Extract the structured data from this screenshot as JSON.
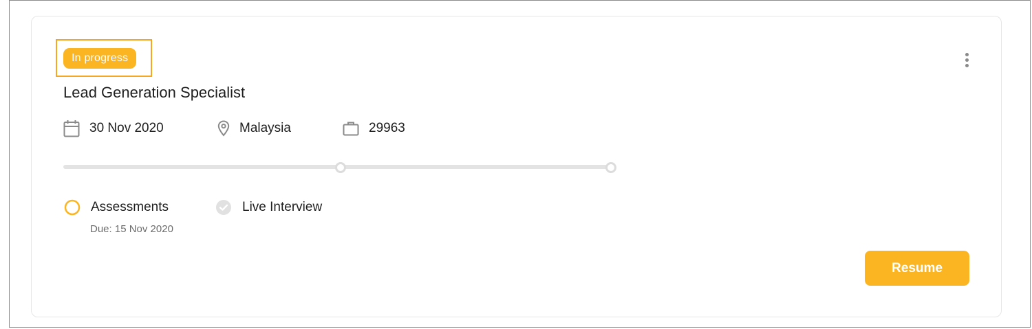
{
  "card": {
    "status_badge": "In progress",
    "job_title": "Lead Generation Specialist",
    "meta": {
      "date": "30 Nov 2020",
      "location": "Malaysia",
      "job_id": "29963"
    },
    "progress": {
      "filled_fraction": 0.0,
      "steps_total": 2
    },
    "steps": [
      {
        "label": "Assessments",
        "due": "Due: 15 Nov 2020",
        "state": "current",
        "icon": "empty-circle-icon"
      },
      {
        "label": "Live Interview",
        "state": "pending",
        "icon": "check-circle-icon"
      }
    ],
    "actions": {
      "resume_label": "Resume"
    }
  },
  "colors": {
    "accent": "#fbb523",
    "highlight_border": "#f5a623",
    "track": "#e3e3e3",
    "text": "#1f1f1f",
    "muted": "#6b6b6b"
  },
  "icons": {
    "date": "calendar-icon",
    "location": "location-pin-icon",
    "job_id": "briefcase-icon",
    "menu": "kebab-menu-icon"
  }
}
